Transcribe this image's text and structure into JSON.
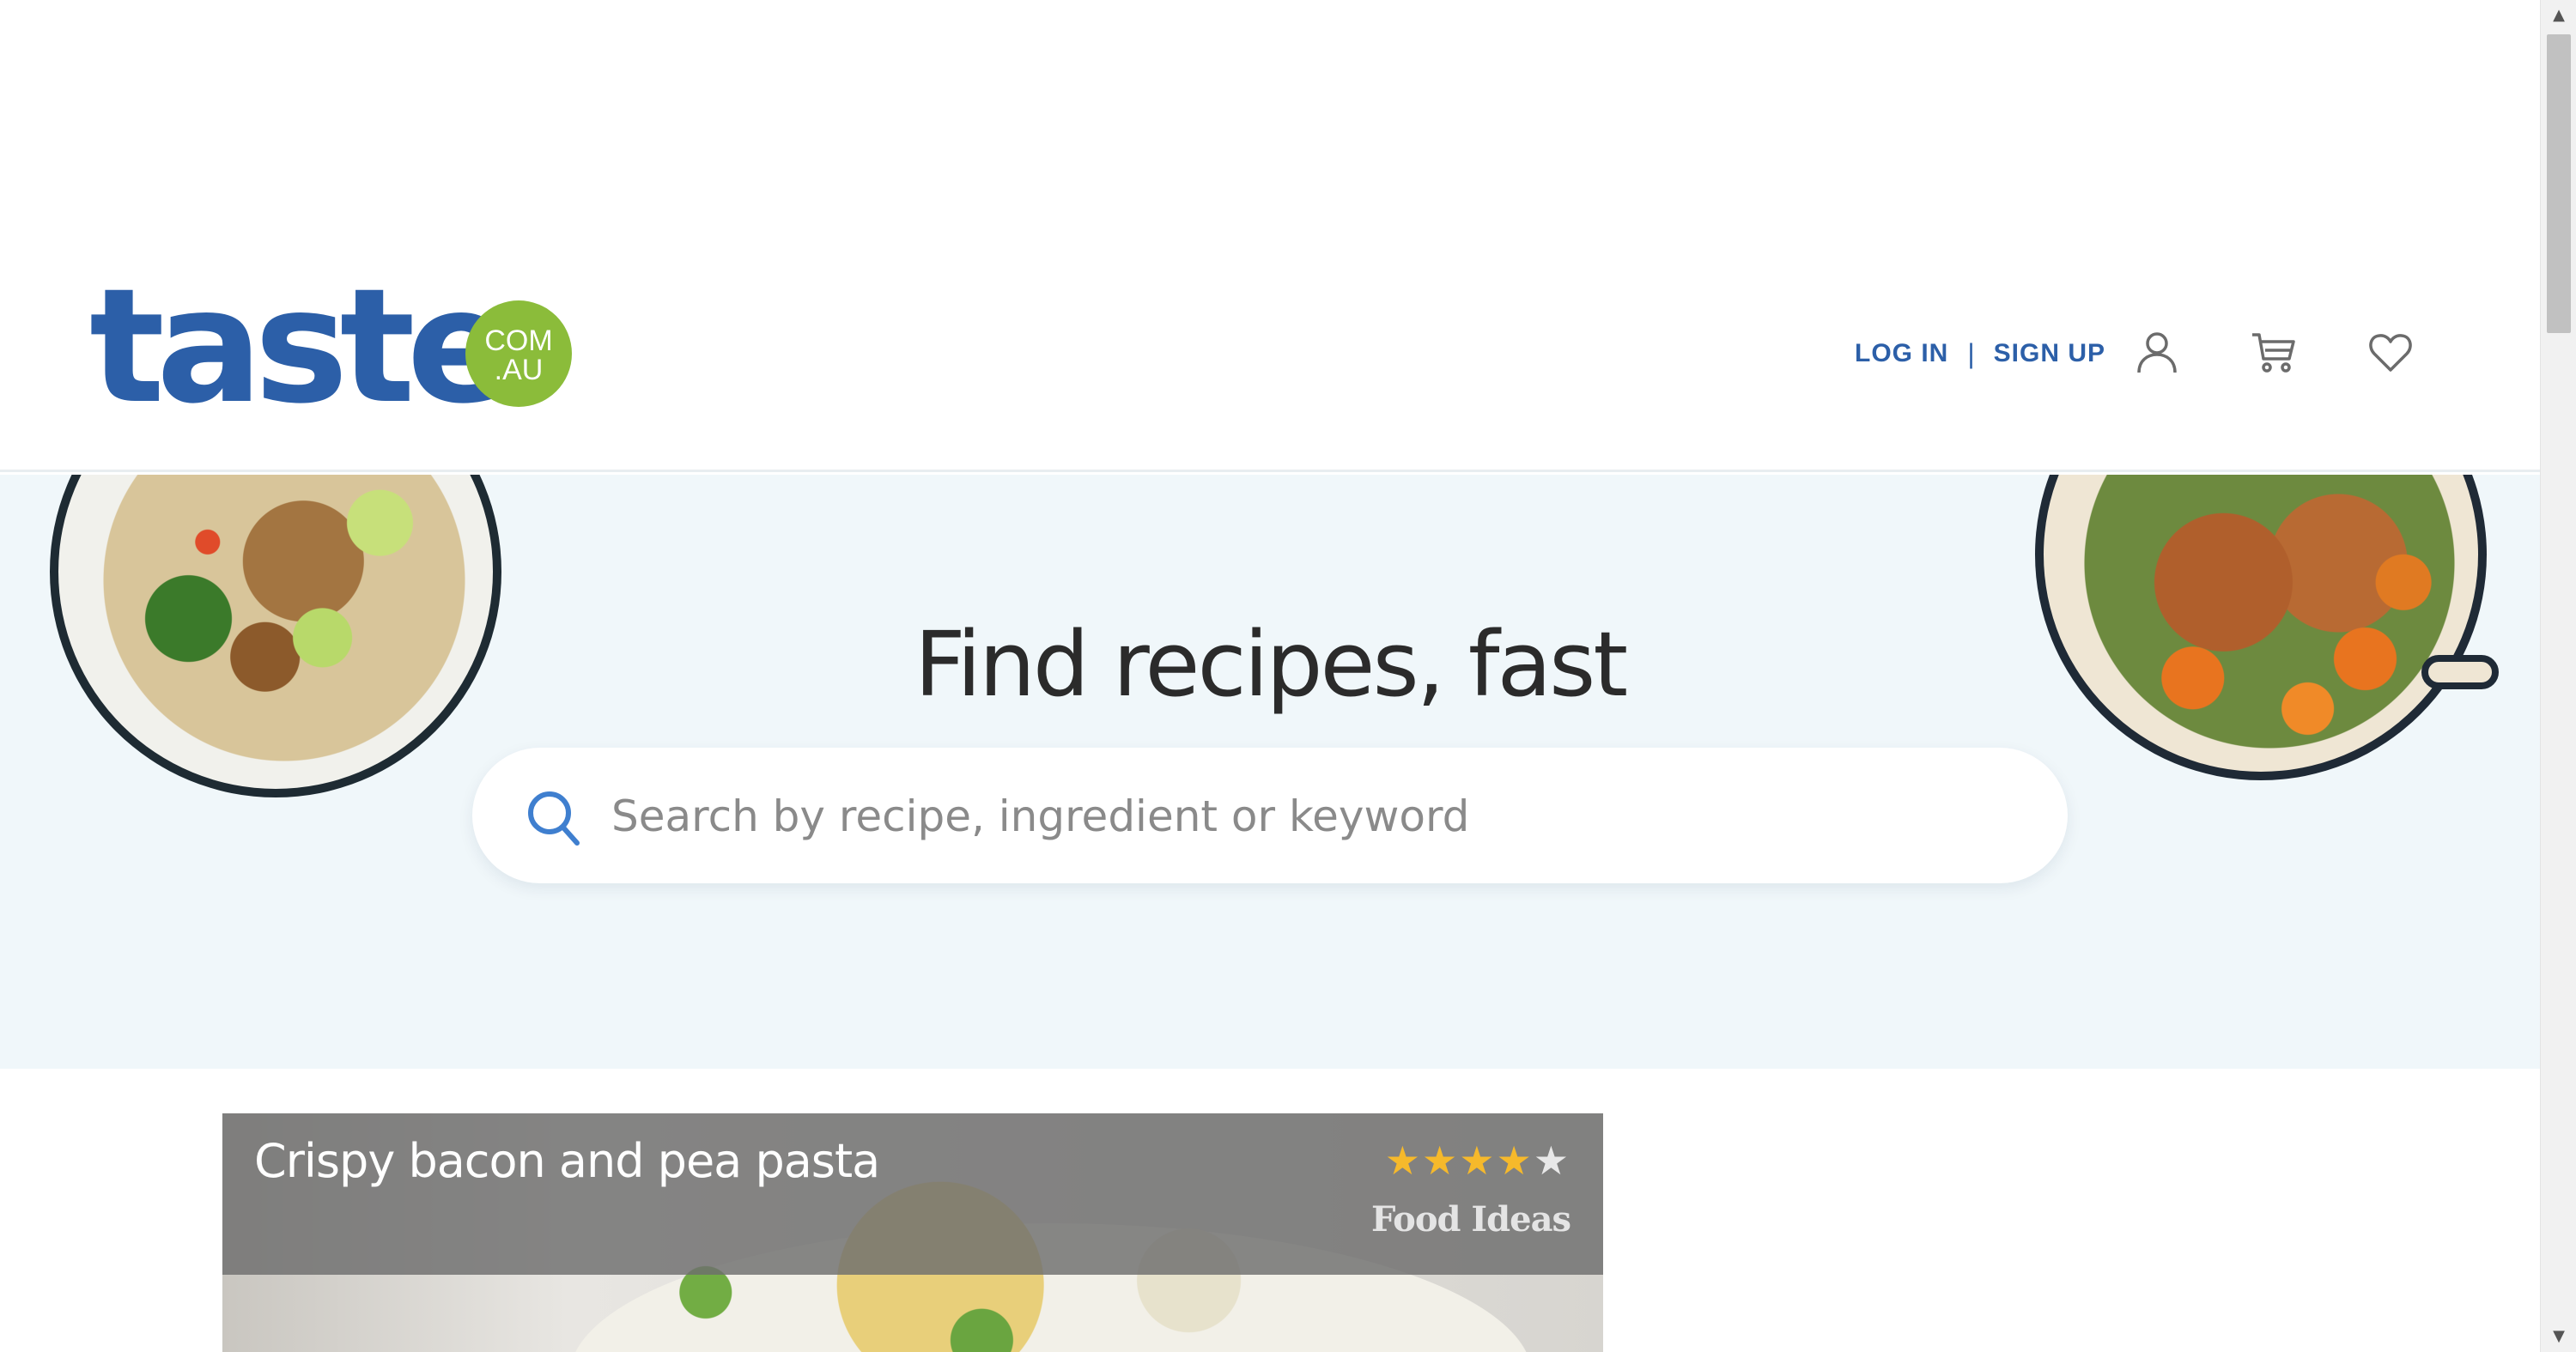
{
  "header": {
    "logo": {
      "word": "taste",
      "badge_top": "COM",
      "badge_bottom": ".AU"
    },
    "login_label": "LOG IN",
    "separator": "|",
    "signup_label": "SIGN UP",
    "icons": [
      "account-icon",
      "cart-icon",
      "favourites-heart-icon"
    ]
  },
  "hero": {
    "title": "Find recipes, fast",
    "search": {
      "placeholder": "Search by recipe, ingredient or keyword",
      "value": ""
    }
  },
  "featured_recipe": {
    "title": "Crispy bacon and pea pasta",
    "rating": 4,
    "rating_max": 5,
    "stars": [
      "★",
      "★",
      "★",
      "★",
      "★"
    ],
    "source": "Food Ideas"
  },
  "colors": {
    "brand_blue": "#2c5fa8",
    "brand_green": "#8bbc3a",
    "hero_bg": "#f0f7fa",
    "star_gold": "#f6b92b"
  },
  "scrollbar": {
    "up_arrow": "▲",
    "down_arrow": "▼"
  }
}
